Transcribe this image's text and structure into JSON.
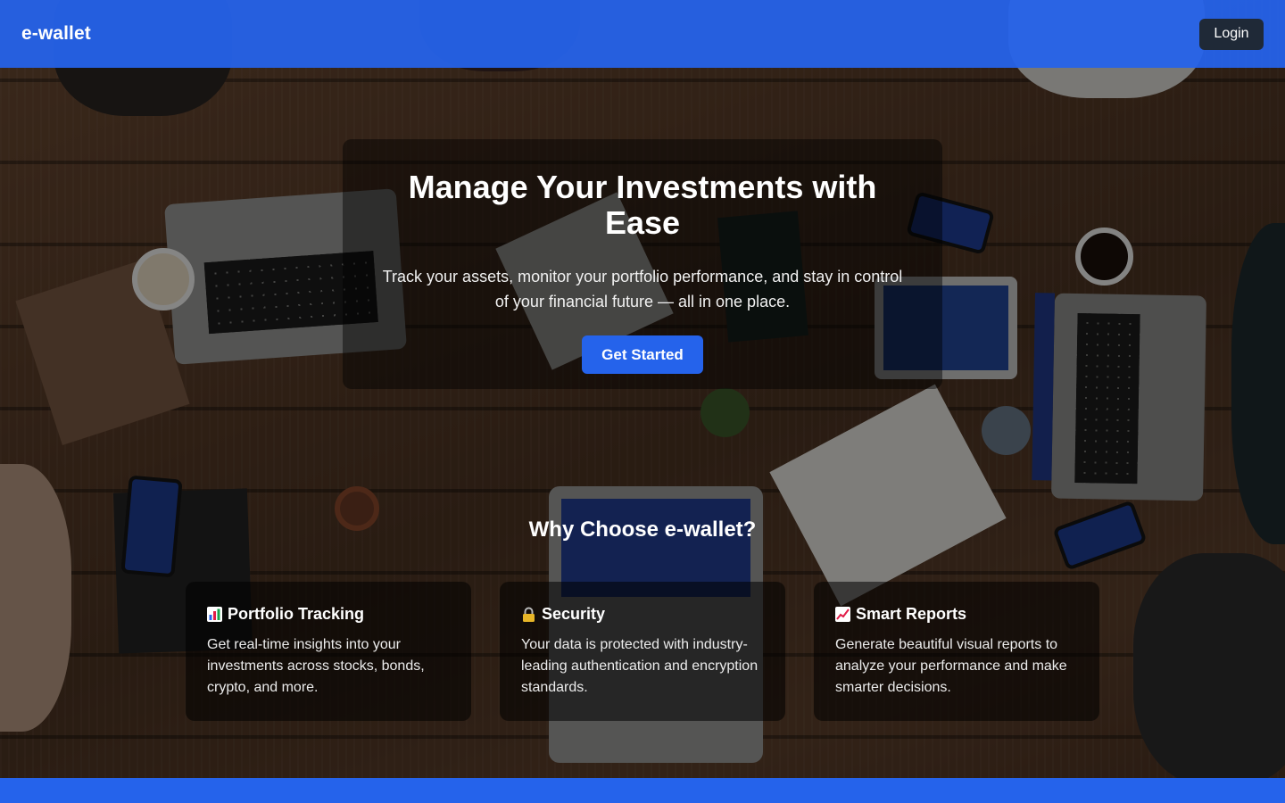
{
  "header": {
    "logo": "e-wallet",
    "login_label": "Login"
  },
  "hero": {
    "title": "Manage Your Investments with Ease",
    "subtitle": "Track your assets, monitor your portfolio performance, and stay in control of your financial future — all in one place.",
    "cta_label": "Get Started"
  },
  "features": {
    "heading": "Why Choose e-wallet?",
    "cards": [
      {
        "icon": "bar-chart-icon",
        "title": "Portfolio Tracking",
        "text": "Get real-time insights into your investments across stocks, bonds, crypto, and more."
      },
      {
        "icon": "lock-icon",
        "title": "Security",
        "text": "Your data is protected with industry-leading authentication and encryption standards."
      },
      {
        "icon": "trend-chart-icon",
        "title": "Smart Reports",
        "text": "Generate beautiful visual reports to analyze your performance and make smarter decisions."
      }
    ]
  },
  "colors": {
    "brand_blue": "#2563eb",
    "login_bg": "#1f2937"
  }
}
